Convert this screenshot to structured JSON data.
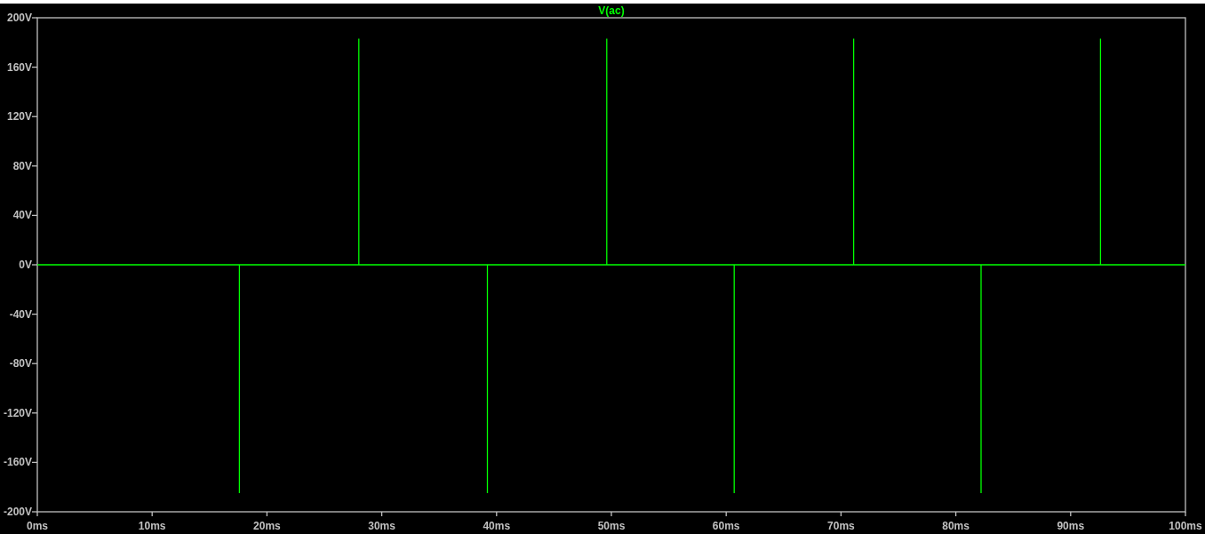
{
  "chart_data": {
    "type": "line",
    "xlim": [
      0,
      100
    ],
    "ylim": [
      -200,
      200
    ],
    "x": [
      0,
      17.6,
      17.6,
      17.6,
      28,
      28,
      28,
      39.2,
      39.2,
      39.2,
      49.6,
      49.6,
      49.6,
      60.7,
      60.7,
      60.7,
      71.1,
      71.1,
      71.1,
      82.2,
      82.2,
      82.2,
      92.6,
      92.6,
      92.6,
      100
    ],
    "series": [
      {
        "name": "V(ac)",
        "color": "#00ff00",
        "values": [
          0,
          0,
          -185,
          0,
          0,
          183,
          0,
          0,
          -185,
          0,
          0,
          183,
          0,
          0,
          -185,
          0,
          0,
          183,
          0,
          0,
          -185,
          0,
          0,
          183,
          0,
          0
        ]
      }
    ],
    "xticks": [
      {
        "value": 0,
        "label": "0ms"
      },
      {
        "value": 10,
        "label": "10ms"
      },
      {
        "value": 20,
        "label": "20ms"
      },
      {
        "value": 30,
        "label": "30ms"
      },
      {
        "value": 40,
        "label": "40ms"
      },
      {
        "value": 50,
        "label": "50ms"
      },
      {
        "value": 60,
        "label": "60ms"
      },
      {
        "value": 70,
        "label": "70ms"
      },
      {
        "value": 80,
        "label": "80ms"
      },
      {
        "value": 90,
        "label": "90ms"
      },
      {
        "value": 100,
        "label": "100ms"
      }
    ],
    "yticks": [
      {
        "value": 200,
        "label": "200V"
      },
      {
        "value": 160,
        "label": "160V"
      },
      {
        "value": 120,
        "label": "120V"
      },
      {
        "value": 80,
        "label": "80V"
      },
      {
        "value": 40,
        "label": "40V"
      },
      {
        "value": 0,
        "label": "0V"
      },
      {
        "value": -40,
        "label": "-40V"
      },
      {
        "value": -80,
        "label": "-80V"
      },
      {
        "value": -120,
        "label": "-120V"
      },
      {
        "value": -160,
        "label": "-160V"
      },
      {
        "value": -200,
        "label": "-200V"
      }
    ]
  }
}
